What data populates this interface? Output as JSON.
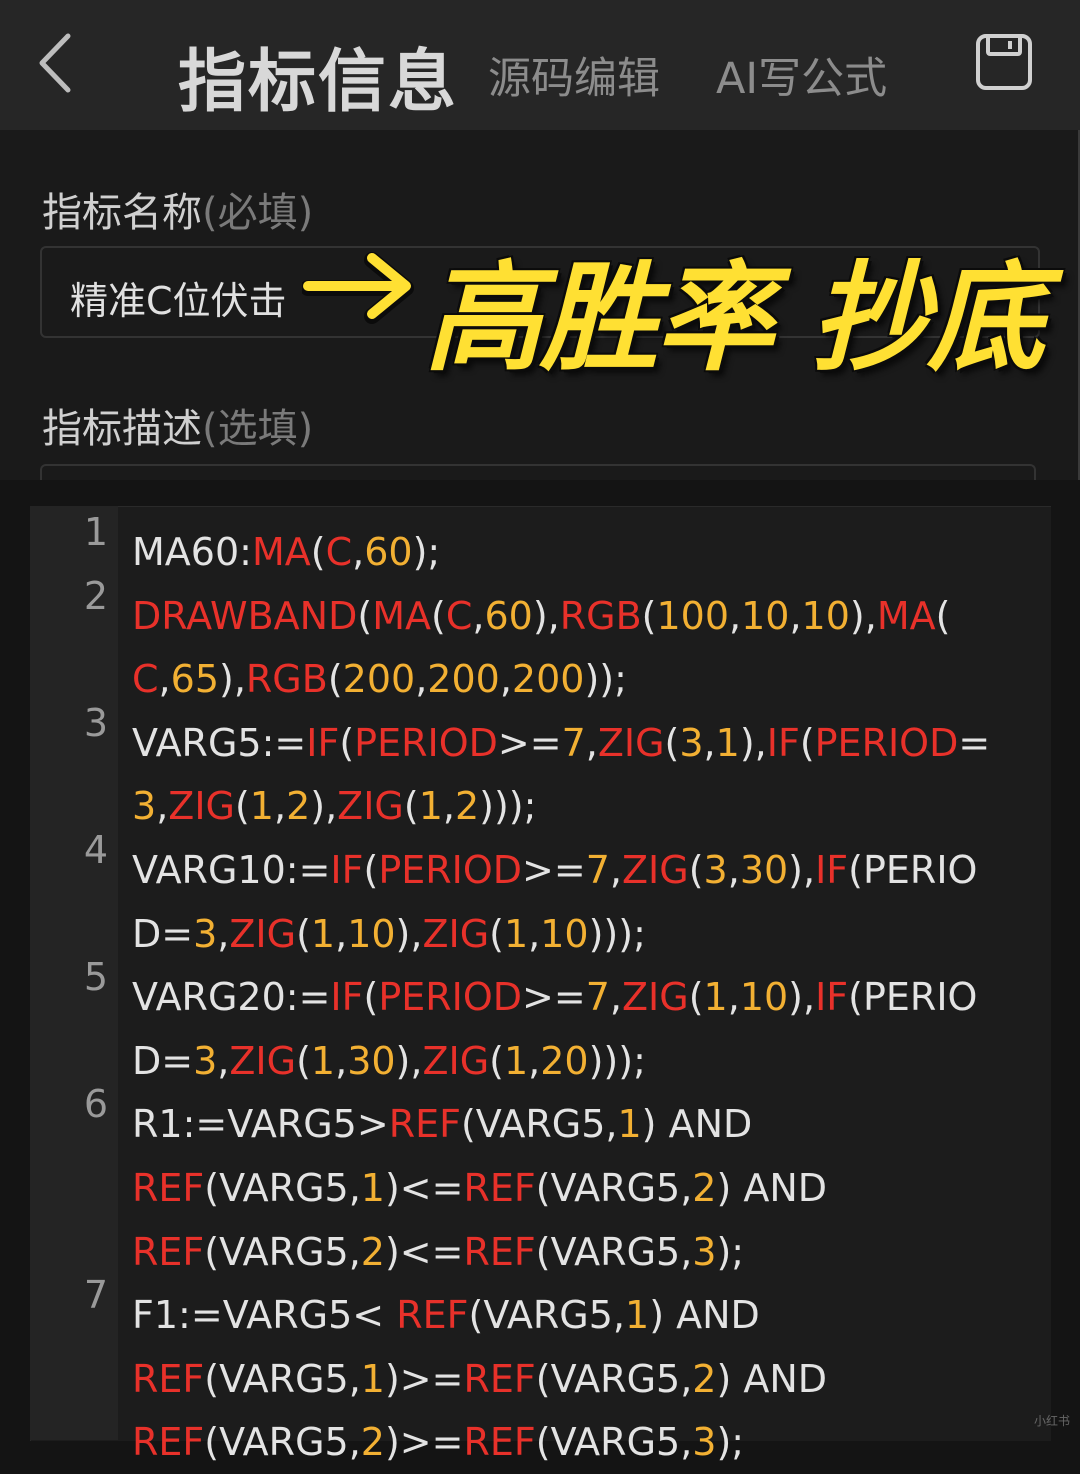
{
  "header": {
    "back_icon": "chevron-left-icon",
    "title": "指标信息",
    "tabs": [
      {
        "label": "源码编辑"
      },
      {
        "label": "AI写公式"
      }
    ],
    "save_icon": "save-icon"
  },
  "form": {
    "name_label": "指标名称",
    "name_hint": "(必填)",
    "name_value": "精准C位伏击",
    "desc_label": "指标描述",
    "desc_hint": "(选填)"
  },
  "overlay": {
    "text": "高胜率 抄底",
    "color": "#ffe033",
    "arrow_icon": "arrow-right-icon"
  },
  "colors": {
    "function": "#e8312a",
    "number": "#f2b033",
    "plain": "#e3e3e3"
  },
  "editor": {
    "lines": [
      {
        "no": "1",
        "rows": [
          "MA60:MA(C,60);"
        ]
      },
      {
        "no": "2",
        "rows": [
          "DRAWBAND(MA(C,60),RGB(100,10,10),MA(",
          "C,65),RGB(200,200,200));"
        ]
      },
      {
        "no": "3",
        "rows": [
          "VARG5:=IF(PERIOD>=7,ZIG(3,1),IF(PERIOD=",
          "3,ZIG(1,2),ZIG(1,2)));"
        ]
      },
      {
        "no": "4",
        "rows": [
          "VARG10:=IF(PERIOD>=7,ZIG(3,30),IF(PERIO",
          "D=3,ZIG(1,10),ZIG(1,10)));"
        ]
      },
      {
        "no": "5",
        "rows": [
          "VARG20:=IF(PERIOD>=7,ZIG(1,10),IF(PERIO",
          "D=3,ZIG(1,30),ZIG(1,20)));"
        ]
      },
      {
        "no": "6",
        "rows": [
          "R1:=VARG5>REF(VARG5,1) AND",
          "REF(VARG5,1)<=REF(VARG5,2) AND",
          "REF(VARG5,2)<=REF(VARG5,3);"
        ]
      },
      {
        "no": "7",
        "rows": [
          "F1:=VARG5< REF(VARG5,1) AND",
          "REF(VARG5,1)>=REF(VARG5,2) AND",
          "REF(VARG5,2)>=REF(VARG5,3);"
        ]
      }
    ]
  },
  "watermark": "小红书"
}
